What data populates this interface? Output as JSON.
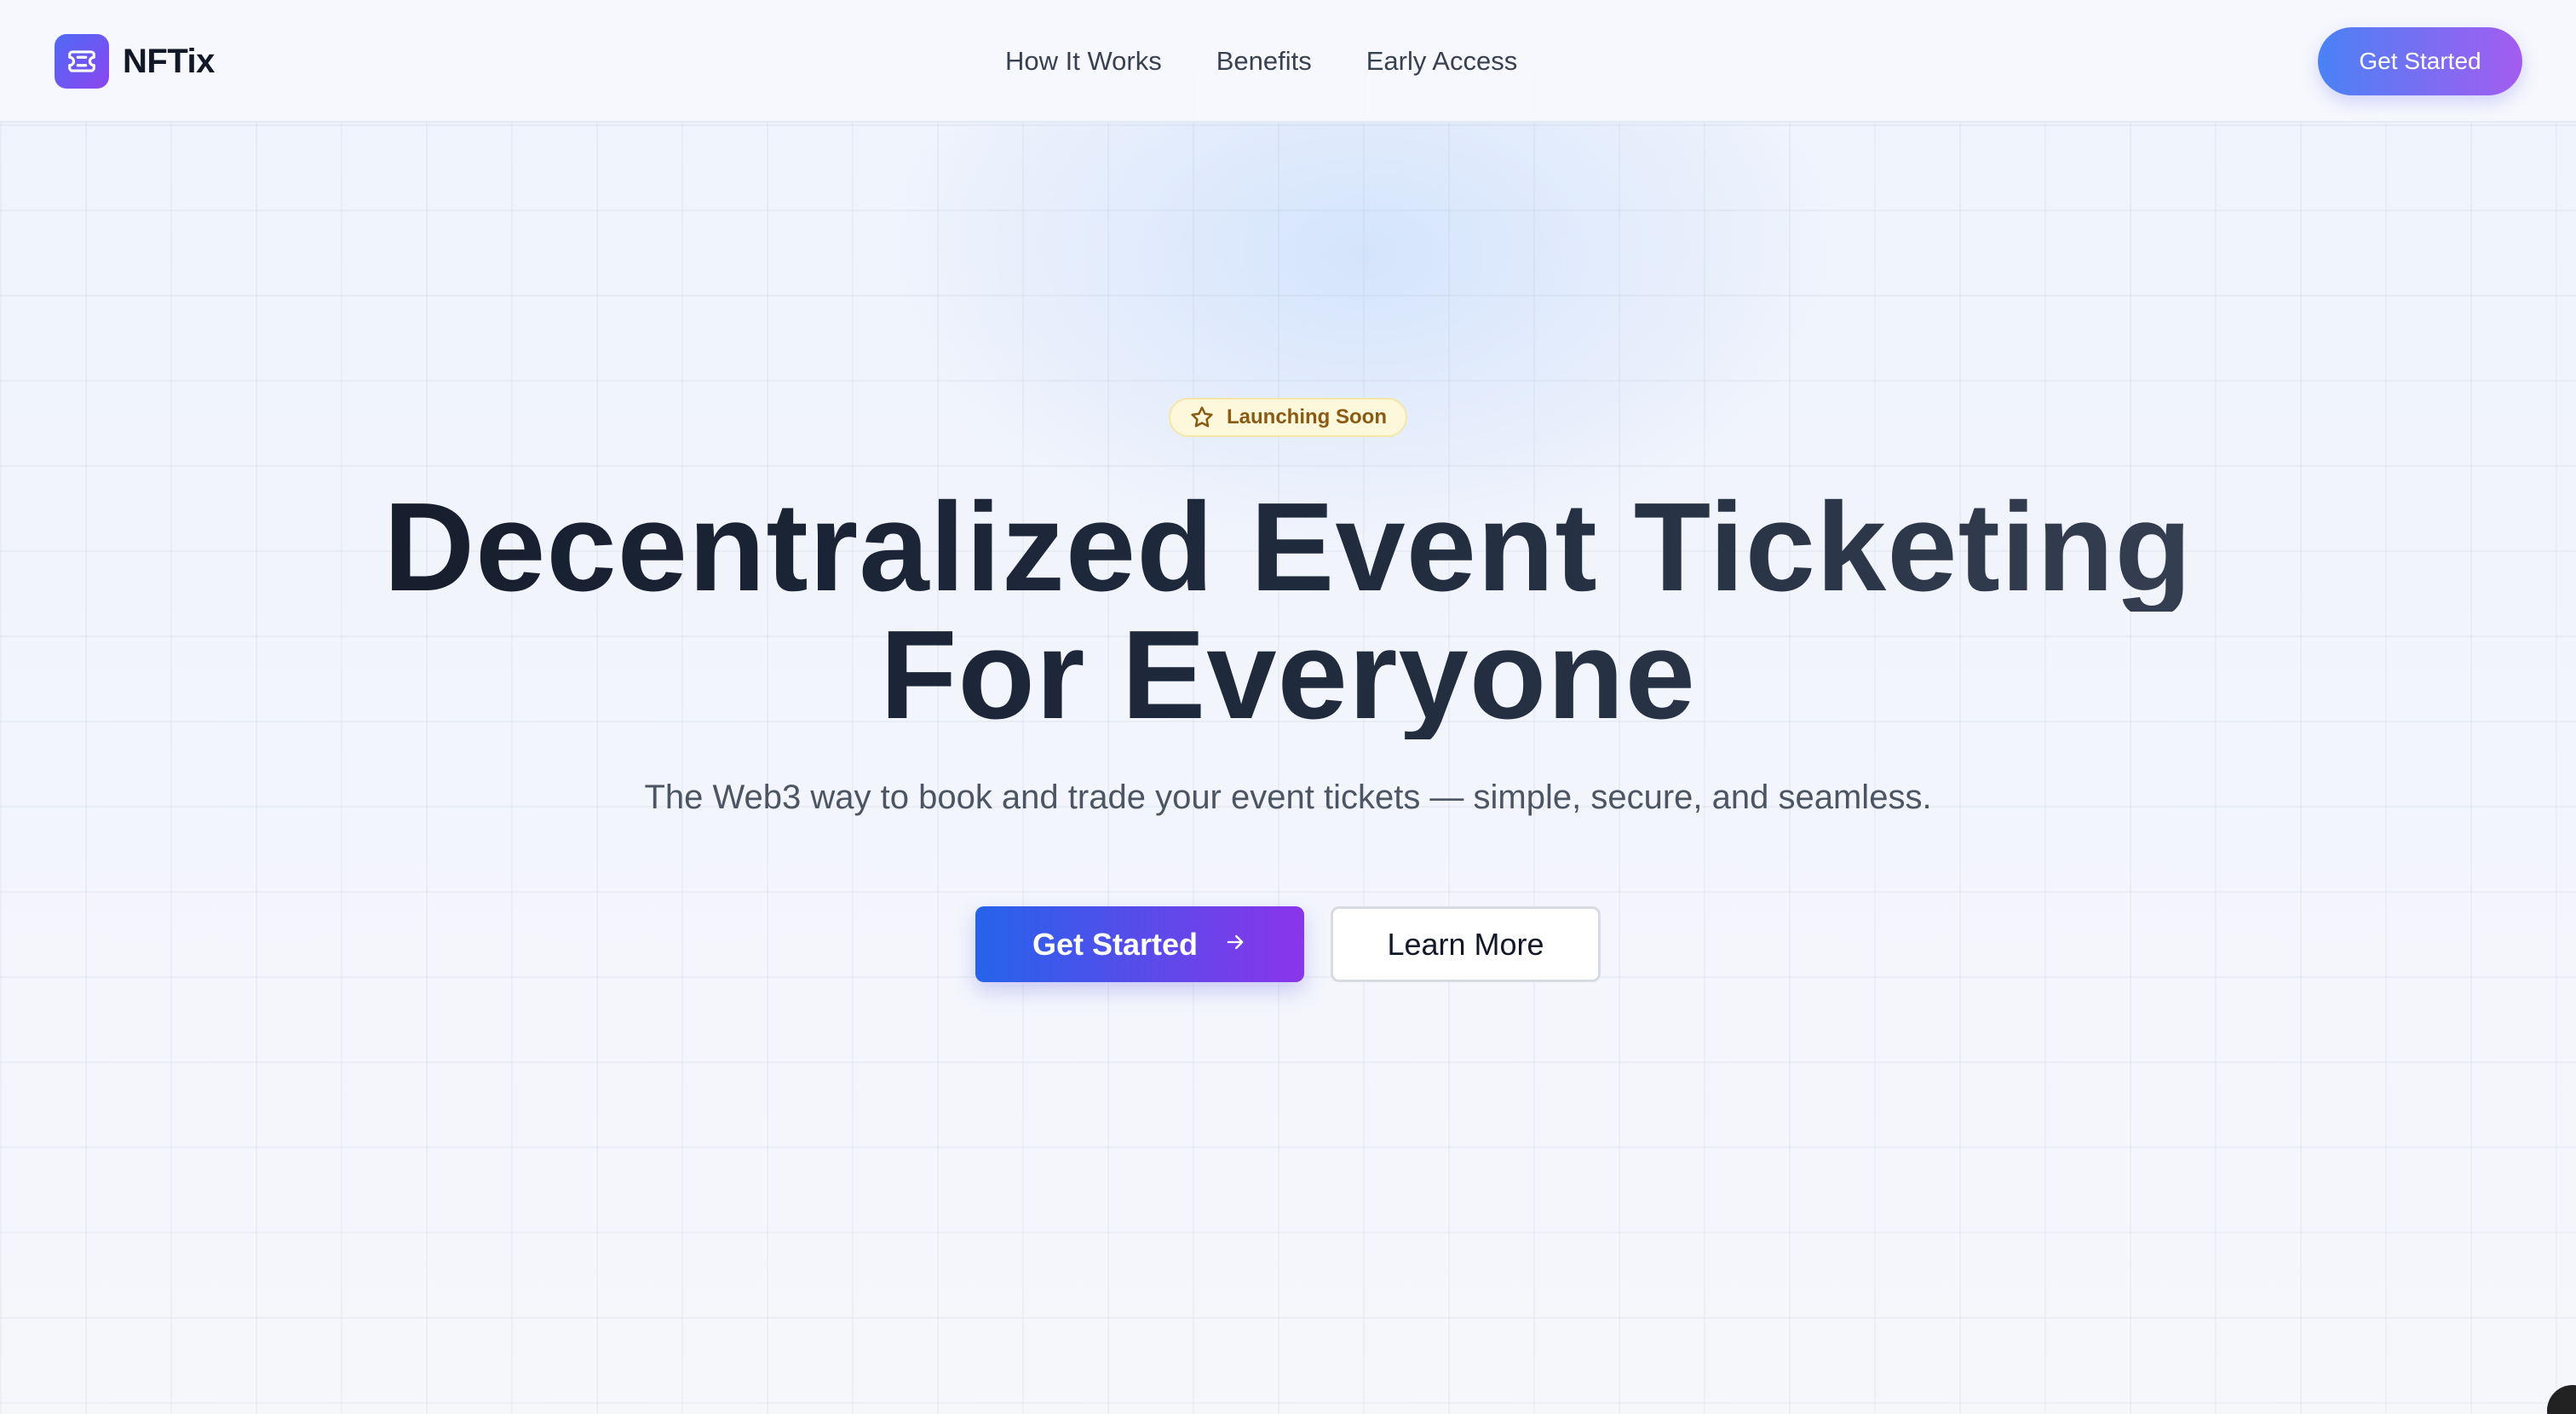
{
  "brand": {
    "name": "NFTix",
    "logo_icon": "ticket-icon",
    "gradient_start": "#4f6bf5",
    "gradient_end": "#8b45ef"
  },
  "nav": {
    "items": [
      {
        "label": "How It Works"
      },
      {
        "label": "Benefits"
      },
      {
        "label": "Early Access"
      }
    ]
  },
  "header": {
    "cta_label": "Get Started"
  },
  "hero": {
    "badge": {
      "icon": "star-icon",
      "label": "Launching Soon"
    },
    "headline_line1": "Decentralized Event Ticketing",
    "headline_line2": "For Everyone",
    "subtitle": "The Web3 way to book and trade your event tickets — simple, secure, and seamless.",
    "primary_button": {
      "label": "Get Started",
      "icon": "arrow-right-icon"
    },
    "secondary_button": {
      "label": "Learn More"
    }
  },
  "colors": {
    "primary_start": "#2563eb",
    "primary_end": "#8a35ea",
    "badge_bg": "#fdf7dc",
    "badge_text": "#8a5a12",
    "heading": "#1a2233"
  }
}
